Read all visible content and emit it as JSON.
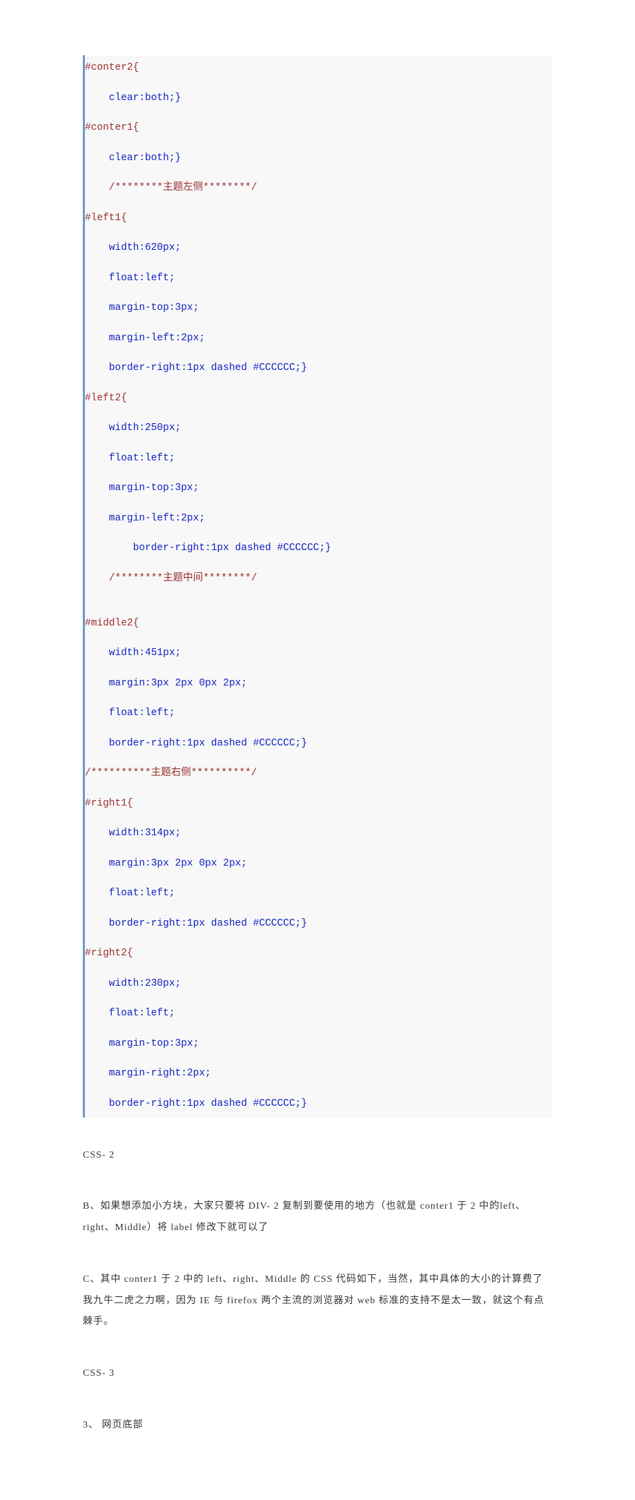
{
  "code": {
    "l1": "#conter2{",
    "l2": "    clear:both;}",
    "l3": "#conter1{",
    "l4": "    clear:both;}",
    "l5": "    /********主题左侧********/",
    "l6": "#left1{",
    "l7": "    width:620px;",
    "l8": "    float:left;",
    "l9": "    margin-top:3px;",
    "l10": "    margin-left:2px;",
    "l11": "    border-right:1px dashed #CCCCCC;}",
    "l12": "#left2{",
    "l13": "    width:250px;",
    "l14": "    float:left;",
    "l15": "    margin-top:3px;",
    "l16": "    margin-left:2px;",
    "l17": "        border-right:1px dashed #CCCCCC;}",
    "l18": "    /********主题中间********/",
    "l19": "",
    "l20": "#middle2{",
    "l21": "    width:451px;",
    "l22": "    margin:3px 2px 0px 2px;",
    "l23": "    float:left;",
    "l24": "    border-right:1px dashed #CCCCCC;}",
    "l25": "/**********主题右侧**********/",
    "l26": "#right1{",
    "l27": "    width:314px;",
    "l28": "    margin:3px 2px 0px 2px;",
    "l29": "    float:left;",
    "l30": "    border-right:1px dashed #CCCCCC;}",
    "l31": "#right2{",
    "l32": "    width:230px;",
    "l33": "    float:left;",
    "l34": "    margin-top:3px;",
    "l35": "    margin-right:2px;",
    "l36": "    border-right:1px dashed #CCCCCC;}"
  },
  "text": {
    "label_css2": "CSS- 2",
    "para_b": "B、如果想添加小方块，大家只要将 DIV- 2 复制到要使用的地方（也就是 conter1 于 2 中的left、right、Middle）将 label 修改下就可以了",
    "para_c": "C、其中 conter1 于 2 中的 left、right、Middle 的 CSS 代码如下，当然，其中具体的大小的计算费了我九牛二虎之力啊，因为 IE 与 firefox 两个主流的浏览器对 web 标准的支持不是太一致，就这个有点棘手。",
    "label_css3": "CSS- 3",
    "footer_heading": "3、  网页底部"
  }
}
